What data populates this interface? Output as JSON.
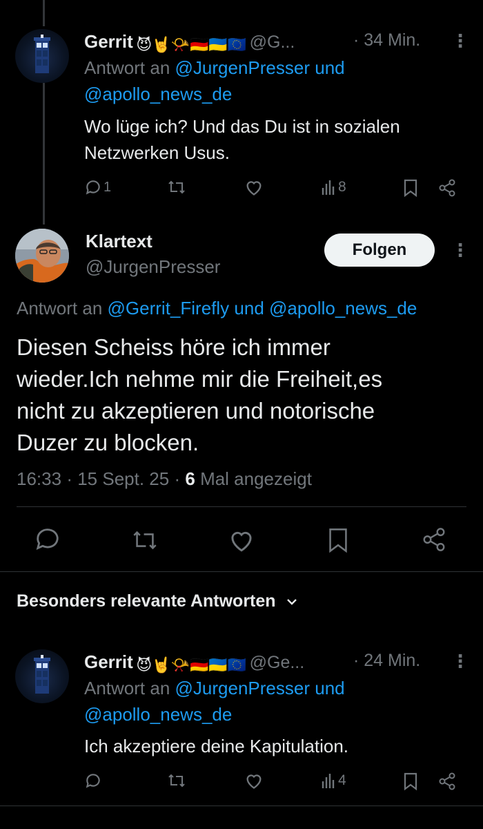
{
  "top_reply": {
    "name": "Gerrit",
    "name_emojis": "😈🤘📯🇩🇪🇺🇦🇪🇺",
    "handle": "@G...",
    "time": "· 34 Min.",
    "reply_prefix": "Antwort an",
    "reply_to_1": "@JurgenPresser",
    "reply_and": "und",
    "reply_to_2": "@apollo_news_de",
    "text_line1": "Wo lüge ich? Und das Du ist in sozialen",
    "text_line2": "Netzwerken Usus.",
    "reply_count": "1",
    "views": "8"
  },
  "main_post": {
    "name": "Klartext",
    "handle": "@JurgenPresser",
    "follow_label": "Folgen",
    "reply_prefix": "Antwort an",
    "reply_to_1": "@Gerrit_Firefly",
    "reply_and": "und",
    "reply_to_2": "@apollo_news_de",
    "text_line1": "Diesen Scheiss höre ich immer",
    "text_line2": "wieder.Ich nehme mir die Freiheit,es",
    "text_line3": "nicht zu akzeptieren und notorische",
    "text_line4": "Duzer zu blocken.",
    "time": "16:33",
    "date": "15 Sept. 25",
    "views_count": "6",
    "views_label": "Mal angezeigt"
  },
  "sort": {
    "label": "Besonders relevante Antworten"
  },
  "bottom_reply": {
    "name": "Gerrit",
    "name_emojis": "😈🤘📯🇩🇪🇺🇦🇪🇺",
    "handle": "@Ge...",
    "time": "· 24 Min.",
    "reply_prefix": "Antwort an",
    "reply_to_1": "@JurgenPresser",
    "reply_and": "und",
    "reply_to_2": "@apollo_news_de",
    "text_line1": "Ich akzeptiere deine Kapitulation.",
    "views": "4"
  },
  "colors": {
    "background": "#000000",
    "text": "#e7e9ea",
    "secondary": "#71767b",
    "link": "#1d9bf0",
    "divider": "#2f3336"
  }
}
